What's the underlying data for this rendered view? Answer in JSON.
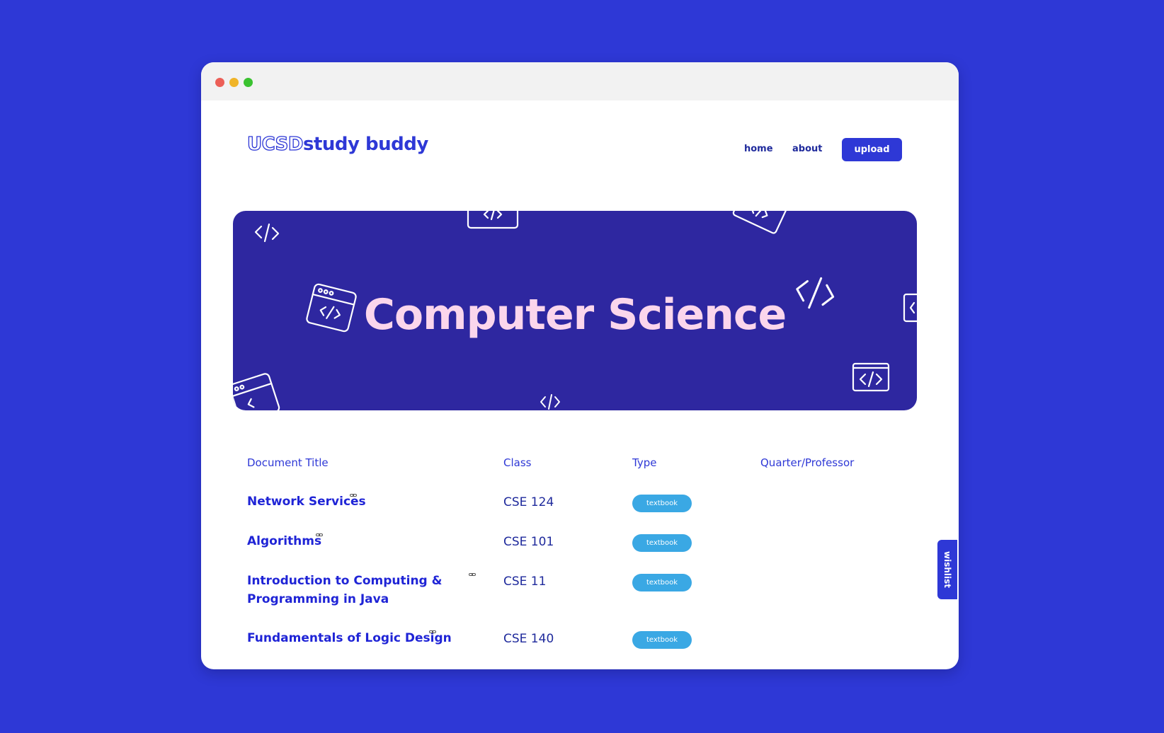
{
  "window": {
    "controls": [
      "close",
      "minimize",
      "maximize"
    ]
  },
  "header": {
    "logo_outline": "UCSD",
    "logo_text": "study buddy",
    "nav": {
      "home": "home",
      "about": "about",
      "upload": "upload"
    }
  },
  "banner": {
    "title": "Computer Science",
    "icons": [
      "code-icon",
      "code-window-icon",
      "browser-window-icon"
    ]
  },
  "table": {
    "headers": {
      "title": "Document Title",
      "class": "Class",
      "type": "Type",
      "quarter": "Quarter/Professor"
    },
    "rows": [
      {
        "title": "Network Services",
        "title_line2": "",
        "class": "CSE 124",
        "type": "textbook"
      },
      {
        "title": "Algorithms",
        "title_line2": "",
        "class": "CSE 101",
        "type": "textbook"
      },
      {
        "title": "Introduction to Computing &",
        "title_line2": "Programming in Java",
        "class": "CSE 11",
        "type": "textbook"
      },
      {
        "title": "Fundamentals of Logic Design",
        "title_line2": "",
        "class": "CSE 140",
        "type": "textbook"
      }
    ]
  },
  "wishlist": {
    "label": "wishlist"
  },
  "colors": {
    "background": "#2e38d6",
    "banner": "#2e27a0",
    "banner_title": "#fbd6ec",
    "badge": "#3aa8e4",
    "link": "#1f24d6"
  }
}
